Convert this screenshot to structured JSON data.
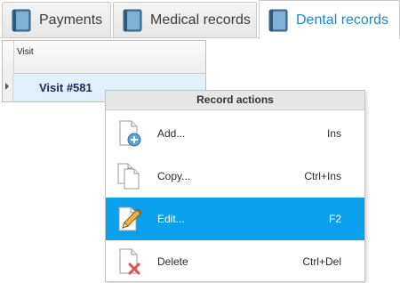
{
  "tabs": [
    {
      "label": "Payments",
      "icon": "book-icon",
      "active": false
    },
    {
      "label": "Medical records",
      "icon": "book-icon",
      "active": false
    },
    {
      "label": "Dental records",
      "icon": "book-icon",
      "active": true
    }
  ],
  "grid": {
    "column_header": "Visit",
    "rows": [
      {
        "visit": "Visit #581"
      }
    ]
  },
  "context_menu": {
    "title": "Record actions",
    "items": [
      {
        "label": "Add...",
        "shortcut": "Ins",
        "icon": "add-document-icon"
      },
      {
        "label": "Copy...",
        "shortcut": "Ctrl+Ins",
        "icon": "copy-documents-icon"
      },
      {
        "label": "Edit...",
        "shortcut": "F2",
        "icon": "edit-pencil-icon",
        "highlighted": true
      },
      {
        "label": "Delete",
        "shortcut": "Ctrl+Del",
        "icon": "delete-document-icon"
      }
    ]
  },
  "colors": {
    "active_tab_text": "#1e88d2",
    "menu_highlight": "#0aa0ec",
    "selected_row": "#dff0fb",
    "book_cover": "#4a7ea8"
  }
}
